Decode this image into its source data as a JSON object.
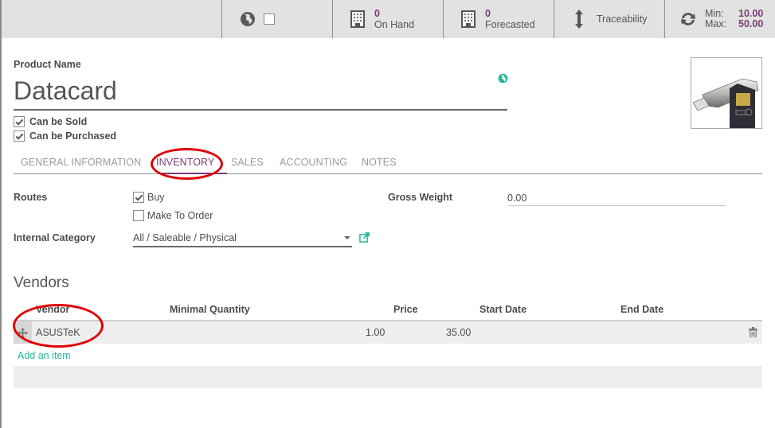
{
  "topbar": {
    "active_toggle": {
      "icon": "globe-icon",
      "checked": false
    },
    "on_hand": {
      "value": "0",
      "label": "On Hand",
      "icon": "building-icon"
    },
    "forecasted": {
      "value": "0",
      "label": "Forecasted",
      "icon": "building-icon"
    },
    "traceability": {
      "label": "Traceability",
      "icon": "vertical-arrows-icon"
    },
    "reordering": {
      "icon": "refresh-icon",
      "min_label": "Min:",
      "min_value": "10.00",
      "max_label": "Max:",
      "max_value": "50.00"
    }
  },
  "header": {
    "product_name_label": "Product Name",
    "product_name": "Datacard",
    "translate_icon": "globe-icon",
    "image_alt": "USB drive with memory card",
    "can_be_sold": {
      "label": "Can be Sold",
      "checked": true
    },
    "can_be_purchased": {
      "label": "Can be Purchased",
      "checked": true
    }
  },
  "tabs": [
    {
      "label": "GENERAL INFORMATION",
      "active": false
    },
    {
      "label": "INVENTORY",
      "active": true
    },
    {
      "label": "SALES",
      "active": false
    },
    {
      "label": "ACCOUNTING",
      "active": false
    },
    {
      "label": "NOTES",
      "active": false
    }
  ],
  "inventory": {
    "routes_label": "Routes",
    "routes": [
      {
        "label": "Buy",
        "checked": true
      },
      {
        "label": "Make To Order",
        "checked": false
      }
    ],
    "internal_category_label": "Internal Category",
    "internal_category": "All / Saleable / Physical",
    "gross_weight_label": "Gross Weight",
    "gross_weight": "0.00"
  },
  "vendors": {
    "title": "Vendors",
    "columns": [
      "Vendor",
      "Minimal Quantity",
      "Price",
      "Start Date",
      "End Date"
    ],
    "rows": [
      {
        "vendor": "ASUSTeK",
        "min_qty": "1.00",
        "price": "35.00",
        "start_date": "",
        "end_date": ""
      }
    ],
    "add_item_label": "Add an item"
  },
  "colors": {
    "accent": "#7c3b78",
    "link": "#21b799",
    "annotation": "#e00000",
    "topbar_bg": "#e2e2e0"
  }
}
